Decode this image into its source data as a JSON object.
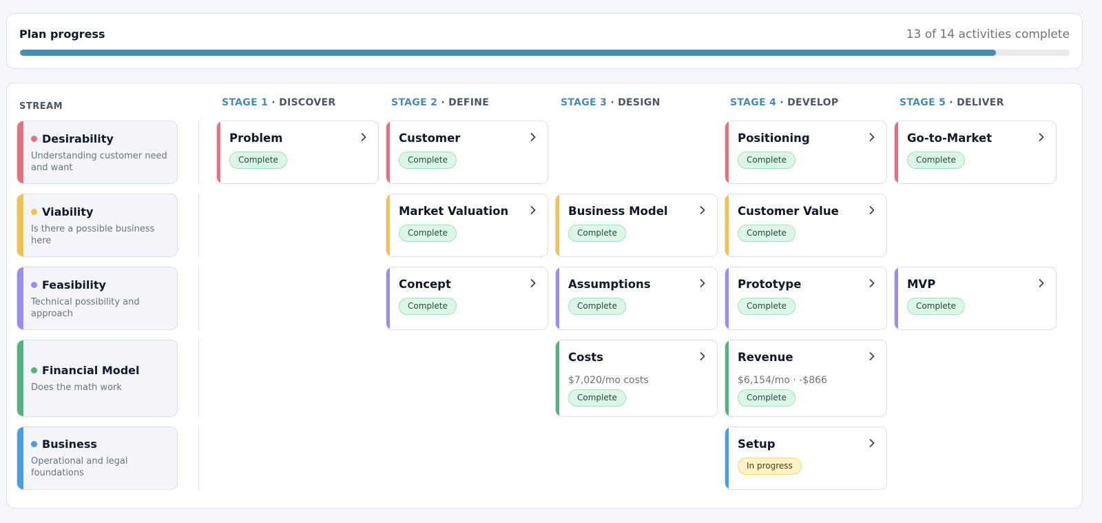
{
  "progress": {
    "title": "Plan progress",
    "count_text": "13 of 14 activities complete",
    "completed": 13,
    "total": 14,
    "fill_fraction": 0.93,
    "bar_color": "#4a8bb0"
  },
  "grid": {
    "stream_header": "STREAM",
    "stages": [
      {
        "num": "STAGE 1",
        "sep": " · ",
        "name": "DISCOVER"
      },
      {
        "num": "STAGE 2",
        "sep": " · ",
        "name": "DEFINE"
      },
      {
        "num": "STAGE 3",
        "sep": " · ",
        "name": "DESIGN"
      },
      {
        "num": "STAGE 4",
        "sep": " · ",
        "name": "DEVELOP"
      },
      {
        "num": "STAGE 5",
        "sep": " · ",
        "name": "DELIVER"
      }
    ]
  },
  "streams": [
    {
      "name": "Desirability",
      "desc": "Understanding customer need and want",
      "color": "#e5707e"
    },
    {
      "name": "Viability",
      "desc": "Is there a possible business here",
      "color": "#f2c14e"
    },
    {
      "name": "Feasibility",
      "desc": "Technical possibility and approach",
      "color": "#9b8cf0"
    },
    {
      "name": "Financial Model",
      "desc": "Does the math work",
      "color": "#4fb47f"
    },
    {
      "name": "Business",
      "desc": "Operational and legal foundations",
      "color": "#4a9ee0"
    }
  ],
  "cards": [
    {
      "stream": 0,
      "stage": 0,
      "title": "Problem",
      "status": "Complete",
      "status_kind": "complete"
    },
    {
      "stream": 0,
      "stage": 1,
      "title": "Customer",
      "status": "Complete",
      "status_kind": "complete"
    },
    {
      "stream": 0,
      "stage": 3,
      "title": "Positioning",
      "status": "Complete",
      "status_kind": "complete"
    },
    {
      "stream": 0,
      "stage": 4,
      "title": "Go-to-Market",
      "status": "Complete",
      "status_kind": "complete"
    },
    {
      "stream": 1,
      "stage": 1,
      "title": "Market Valuation",
      "status": "Complete",
      "status_kind": "complete"
    },
    {
      "stream": 1,
      "stage": 2,
      "title": "Business Model",
      "status": "Complete",
      "status_kind": "complete"
    },
    {
      "stream": 1,
      "stage": 3,
      "title": "Customer Value",
      "status": "Complete",
      "status_kind": "complete"
    },
    {
      "stream": 2,
      "stage": 1,
      "title": "Concept",
      "status": "Complete",
      "status_kind": "complete"
    },
    {
      "stream": 2,
      "stage": 2,
      "title": "Assumptions",
      "status": "Complete",
      "status_kind": "complete"
    },
    {
      "stream": 2,
      "stage": 3,
      "title": "Prototype",
      "status": "Complete",
      "status_kind": "complete"
    },
    {
      "stream": 2,
      "stage": 4,
      "title": "MVP",
      "status": "Complete",
      "status_kind": "complete"
    },
    {
      "stream": 3,
      "stage": 2,
      "title": "Costs",
      "subtitle": "$7,020/mo costs",
      "status": "Complete",
      "status_kind": "complete"
    },
    {
      "stream": 3,
      "stage": 3,
      "title": "Revenue",
      "subtitle": "$6,154/mo · -$866",
      "status": "Complete",
      "status_kind": "complete"
    },
    {
      "stream": 4,
      "stage": 3,
      "title": "Setup",
      "status": "In progress",
      "status_kind": "progress"
    }
  ],
  "icons": {
    "card_action": "chevron-right-icon",
    "stream_marker": "dot-icon"
  }
}
